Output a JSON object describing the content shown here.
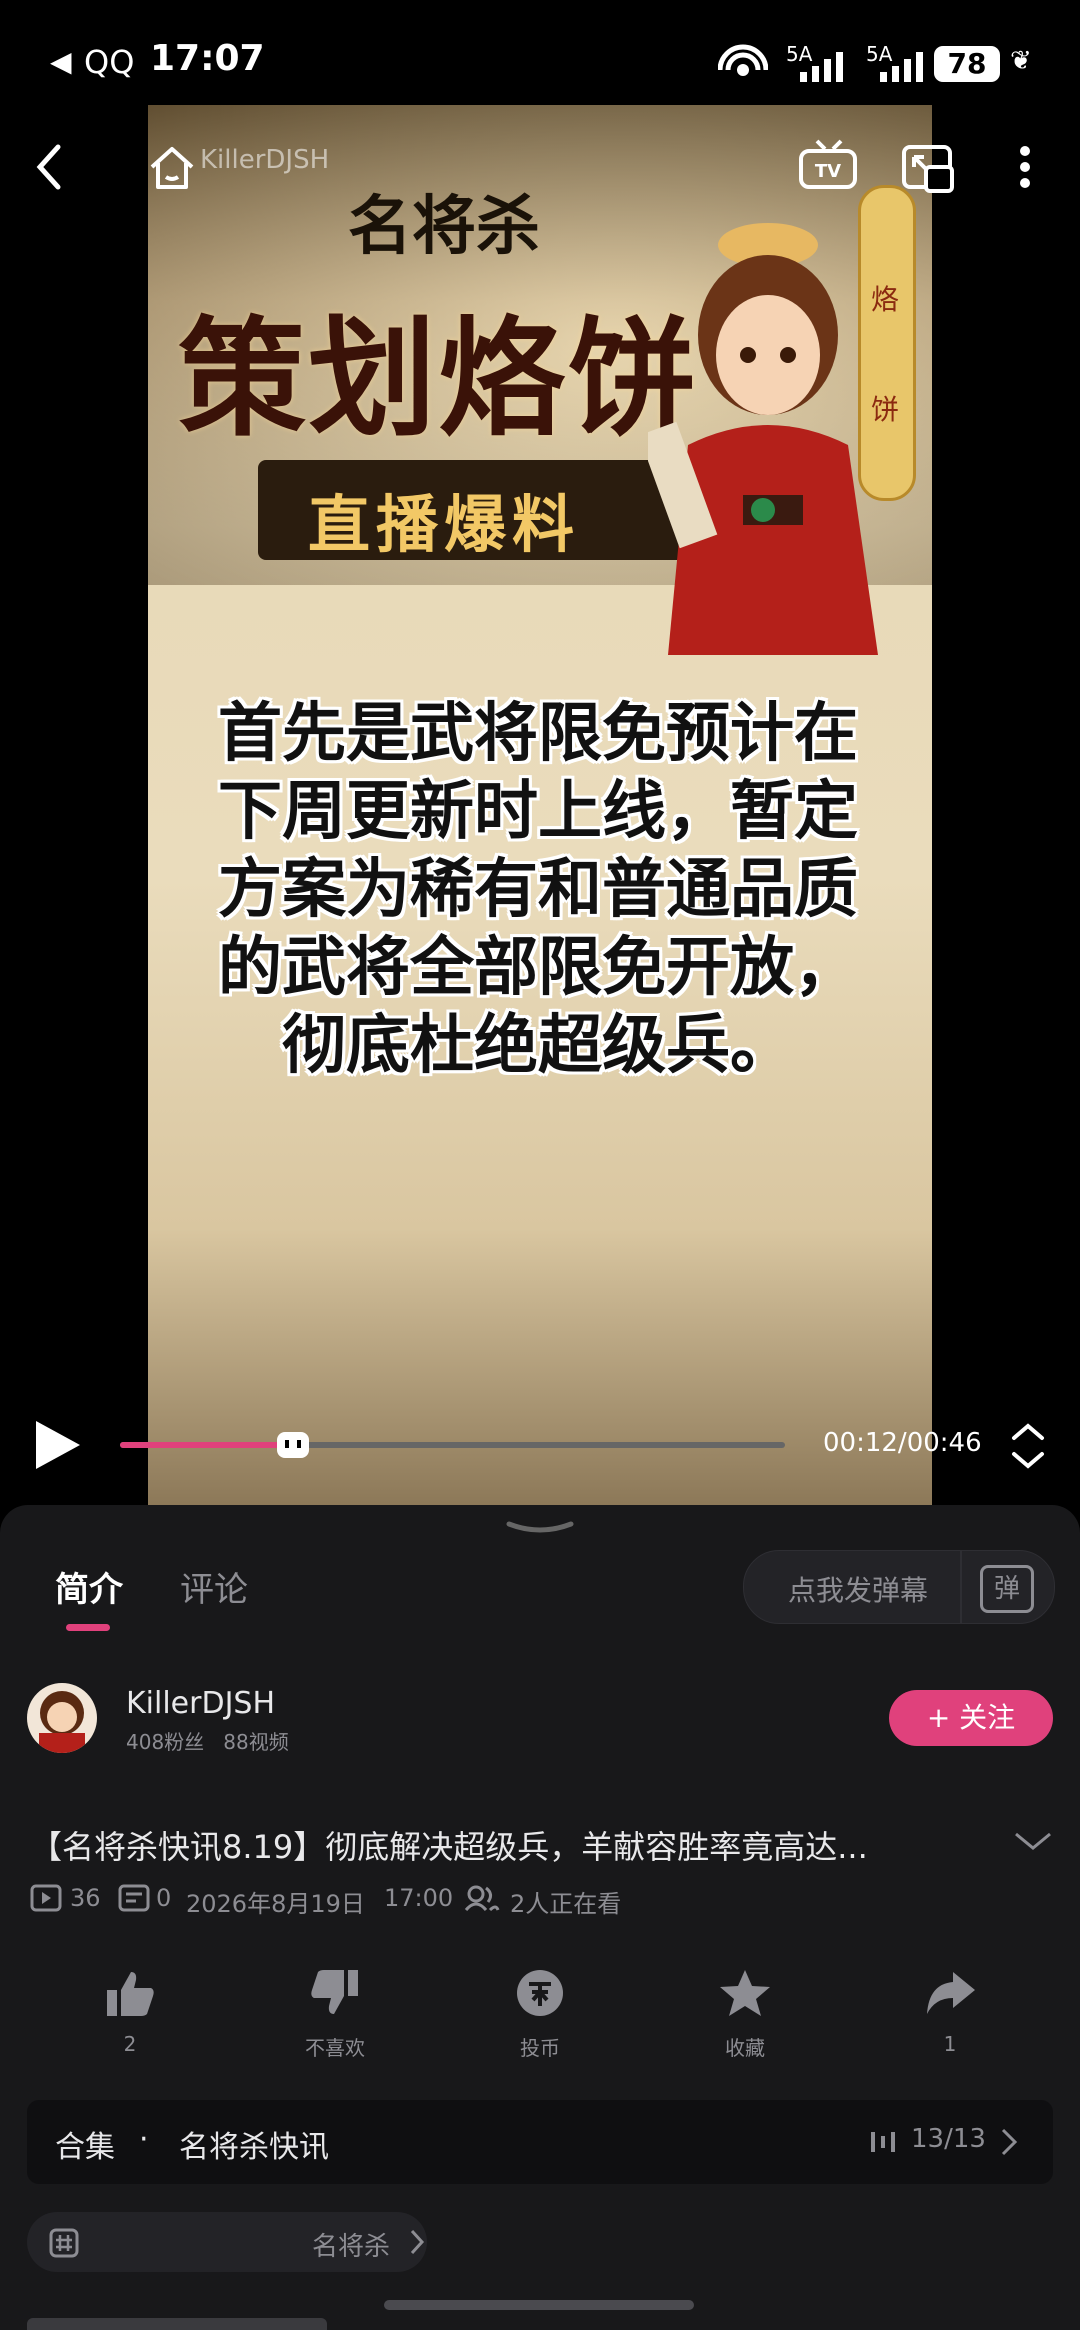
{
  "status_bar": {
    "app_back": "QQ",
    "time": "17:07",
    "network1": "5A",
    "network2": "5A",
    "battery": "78"
  },
  "video": {
    "watermark": "KillerDJSH",
    "poster": {
      "logo_text": "名将杀",
      "headline": "策划烙饼",
      "subheadline": "直播爆料",
      "side_tag": [
        "烙",
        "饼"
      ],
      "body_text": "首先是武将限免预计在下周更新时上线，暂定方案为稀有和普通品质的武将全部限免开放，彻底杜绝超级兵。"
    },
    "player": {
      "time_display": "00:12/00:46",
      "progress": 0.26
    }
  },
  "tabs": {
    "intro": "简介",
    "comments": "评论",
    "danmaku_placeholder": "点我发弹幕",
    "danmaku_icon_text": "弹"
  },
  "uploader": {
    "name": "KillerDJSH",
    "stats": "408粉丝   88视频",
    "follow_label": "+ 关注"
  },
  "video_info": {
    "title": "【名将杀快讯8.19】彻底解决超级兵，羊献容胜率竟高达...",
    "views": "36",
    "danmaku_count": "0",
    "date": "2026年8月19日",
    "time": "17:00",
    "watching": "2人正在看"
  },
  "actions": [
    {
      "label": "2"
    },
    {
      "label": "不喜欢"
    },
    {
      "label": "投币"
    },
    {
      "label": "收藏"
    },
    {
      "label": "1"
    }
  ],
  "collection": {
    "label": "合集",
    "dot": "·",
    "name": "名将杀快讯",
    "count": "13/13"
  },
  "tag_chip": {
    "text": "名将杀"
  },
  "colors": {
    "accent_pink": "#e0417c",
    "sheet_bg": "#18181a"
  }
}
